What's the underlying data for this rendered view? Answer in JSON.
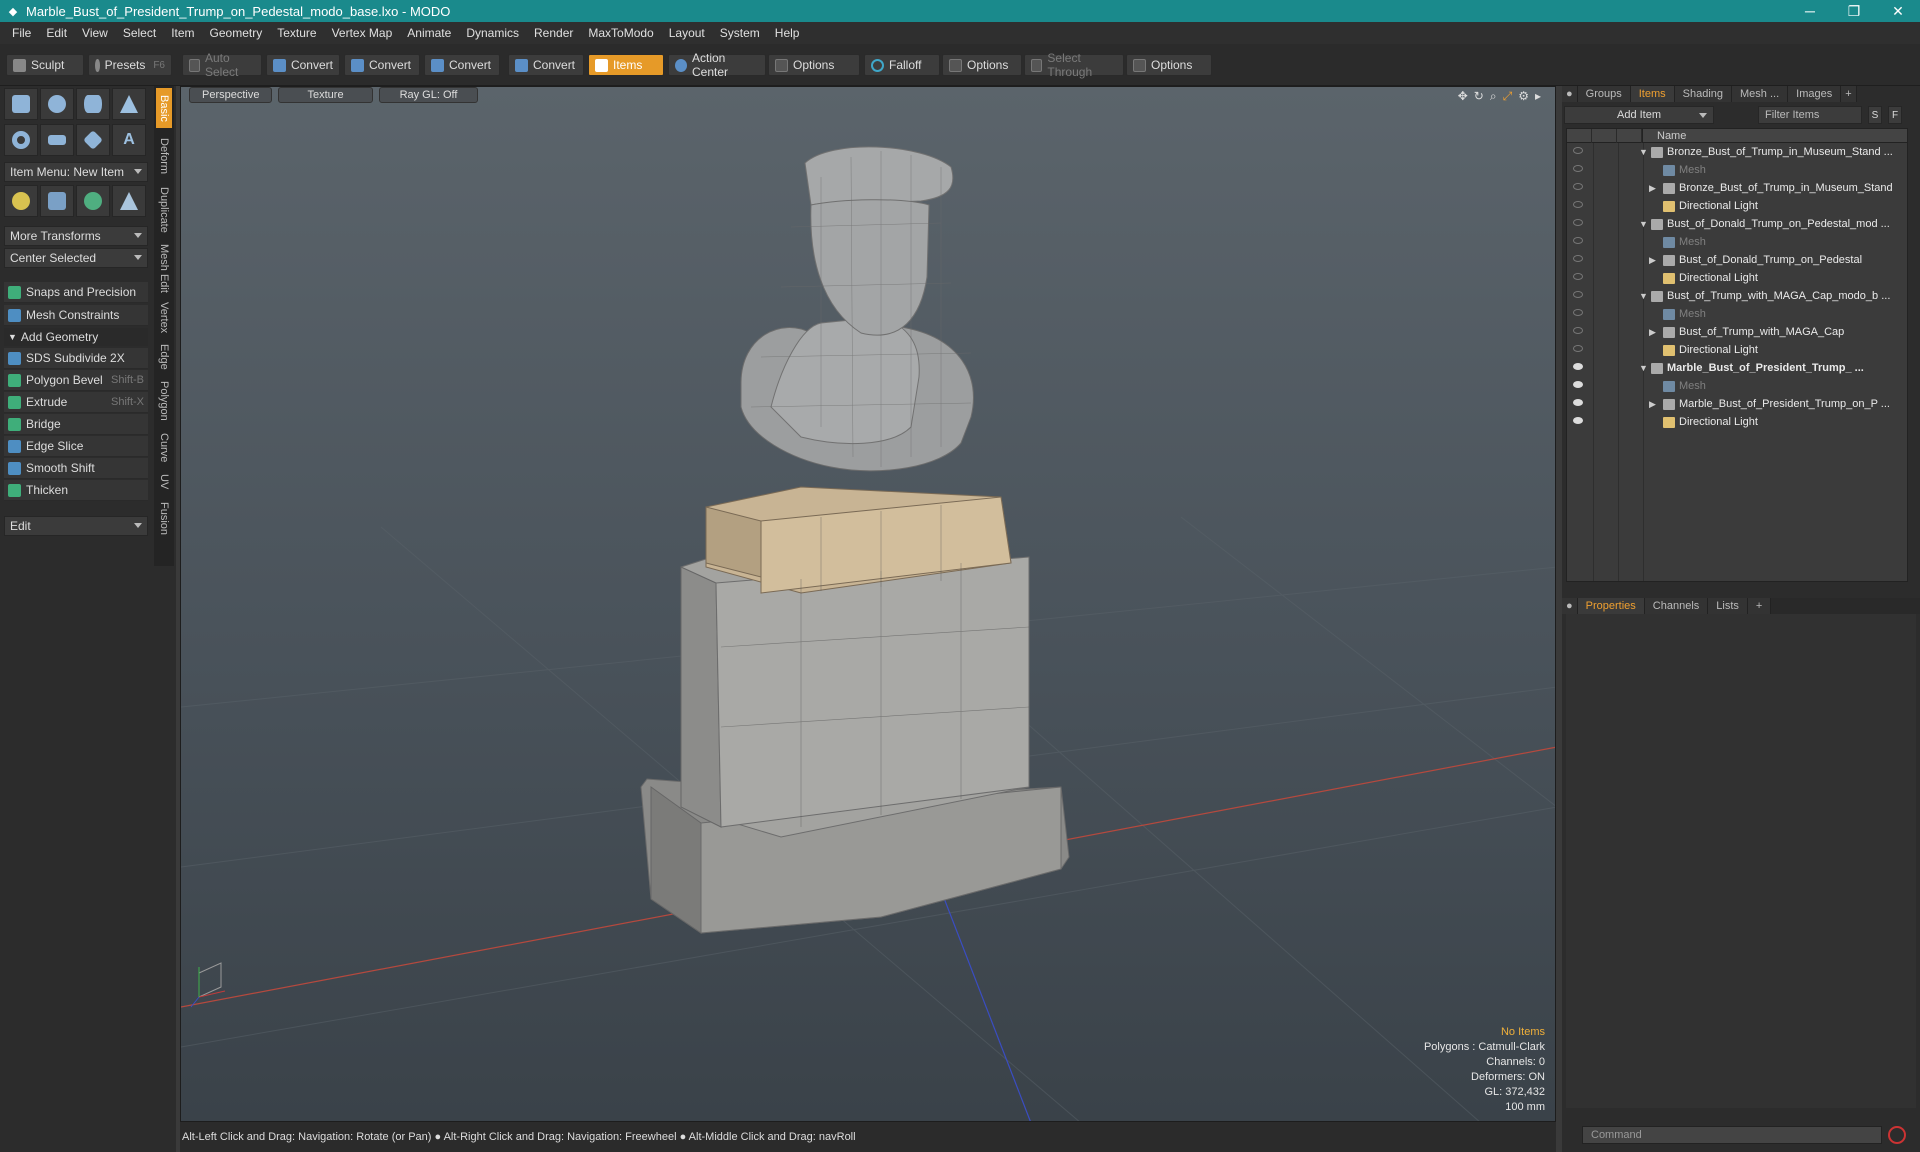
{
  "window": {
    "title": "Marble_Bust_of_President_Trump_on_Pedestal_modo_base.lxo - MODO",
    "minimize": "─",
    "maximize": "❐",
    "close": "✕"
  },
  "menu": [
    "File",
    "Edit",
    "View",
    "Select",
    "Item",
    "Geometry",
    "Texture",
    "Vertex Map",
    "Animate",
    "Dynamics",
    "Render",
    "MaxToModo",
    "Layout",
    "System",
    "Help"
  ],
  "toolbar": {
    "sculpt": "Sculpt",
    "presets": "Presets",
    "presets_key": "F6",
    "auto_select": "Auto Select",
    "convert1": "Convert",
    "convert2": "Convert",
    "convert3": "Convert",
    "convert4": "Convert",
    "items": "Items",
    "action_center": "Action Center",
    "options1": "Options",
    "falloff": "Falloff",
    "options2": "Options",
    "select_through": "Select Through",
    "options3": "Options"
  },
  "left": {
    "item_menu": "Item Menu: New Item",
    "more_transforms": "More Transforms",
    "center_selected": "Center Selected",
    "snaps": "Snaps and Precision",
    "mesh_constraints": "Mesh Constraints",
    "add_geometry": "Add Geometry",
    "tools": [
      {
        "label": "SDS Subdivide 2X",
        "key": ""
      },
      {
        "label": "Polygon Bevel",
        "key": "Shift-B"
      },
      {
        "label": "Extrude",
        "key": "Shift-X"
      },
      {
        "label": "Bridge",
        "key": ""
      },
      {
        "label": "Edge Slice",
        "key": ""
      },
      {
        "label": "Smooth Shift",
        "key": ""
      },
      {
        "label": "Thicken",
        "key": ""
      }
    ],
    "edit": "Edit",
    "vtabs": [
      "Basic",
      "Deform",
      "Duplicate",
      "Mesh Edit",
      "Vertex",
      "Edge",
      "Polygon",
      "Curve",
      "UV",
      "Fusion"
    ]
  },
  "viewport": {
    "perspective": "Perspective",
    "texture": "Texture",
    "raygl": "Ray GL: Off",
    "hud": {
      "no_items": "No Items",
      "polygons": "Polygons : Catmull-Clark",
      "channels": "Channels: 0",
      "deformers": "Deformers: ON",
      "gl": "GL: 372,432",
      "scale": "100 mm"
    }
  },
  "status": "Alt-Left Click and Drag: Navigation: Rotate (or Pan) ● Alt-Right Click and Drag: Navigation: Freewheel ● Alt-Middle Click and Drag: navRoll",
  "right": {
    "tabs": [
      "Groups",
      "Items",
      "Shading",
      "Mesh ...",
      "Images"
    ],
    "add_item": "Add Item",
    "filter": "Filter Items",
    "s": "S",
    "f": "F",
    "name_col": "Name",
    "tree": [
      {
        "label": "Bronze_Bust_of_Trump_in_Museum_Stand ...",
        "level": 0,
        "type": "scene",
        "eye": false,
        "bold": false
      },
      {
        "label": "Mesh",
        "level": 1,
        "type": "mesh",
        "eye": false,
        "dim": true
      },
      {
        "label": "Bronze_Bust_of_Trump_in_Museum_Stand",
        "level": 1,
        "type": "item",
        "eye": false,
        "arrow": true
      },
      {
        "label": "Directional Light",
        "level": 1,
        "type": "light",
        "eye": false
      },
      {
        "label": "Bust_of_Donald_Trump_on_Pedestal_mod ...",
        "level": 0,
        "type": "scene",
        "eye": false
      },
      {
        "label": "Mesh",
        "level": 1,
        "type": "mesh",
        "eye": false,
        "dim": true
      },
      {
        "label": "Bust_of_Donald_Trump_on_Pedestal",
        "level": 1,
        "type": "item",
        "eye": false,
        "arrow": true
      },
      {
        "label": "Directional Light",
        "level": 1,
        "type": "light",
        "eye": false
      },
      {
        "label": "Bust_of_Trump_with_MAGA_Cap_modo_b ...",
        "level": 0,
        "type": "scene",
        "eye": false
      },
      {
        "label": "Mesh",
        "level": 1,
        "type": "mesh",
        "eye": false,
        "dim": true
      },
      {
        "label": "Bust_of_Trump_with_MAGA_Cap",
        "level": 1,
        "type": "item",
        "eye": false,
        "arrow": true
      },
      {
        "label": "Directional Light",
        "level": 1,
        "type": "light",
        "eye": false
      },
      {
        "label": "Marble_Bust_of_President_Trump_ ...",
        "level": 0,
        "type": "scene",
        "eye": true,
        "bold": true
      },
      {
        "label": "Mesh",
        "level": 1,
        "type": "mesh",
        "eye": true,
        "dim": true
      },
      {
        "label": "Marble_Bust_of_President_Trump_on_P ...",
        "level": 1,
        "type": "item",
        "eye": true,
        "arrow": true
      },
      {
        "label": "Directional Light",
        "level": 1,
        "type": "light",
        "eye": true
      }
    ],
    "tabs2": [
      "Properties",
      "Channels",
      "Lists",
      "+"
    ],
    "command": "Command"
  }
}
